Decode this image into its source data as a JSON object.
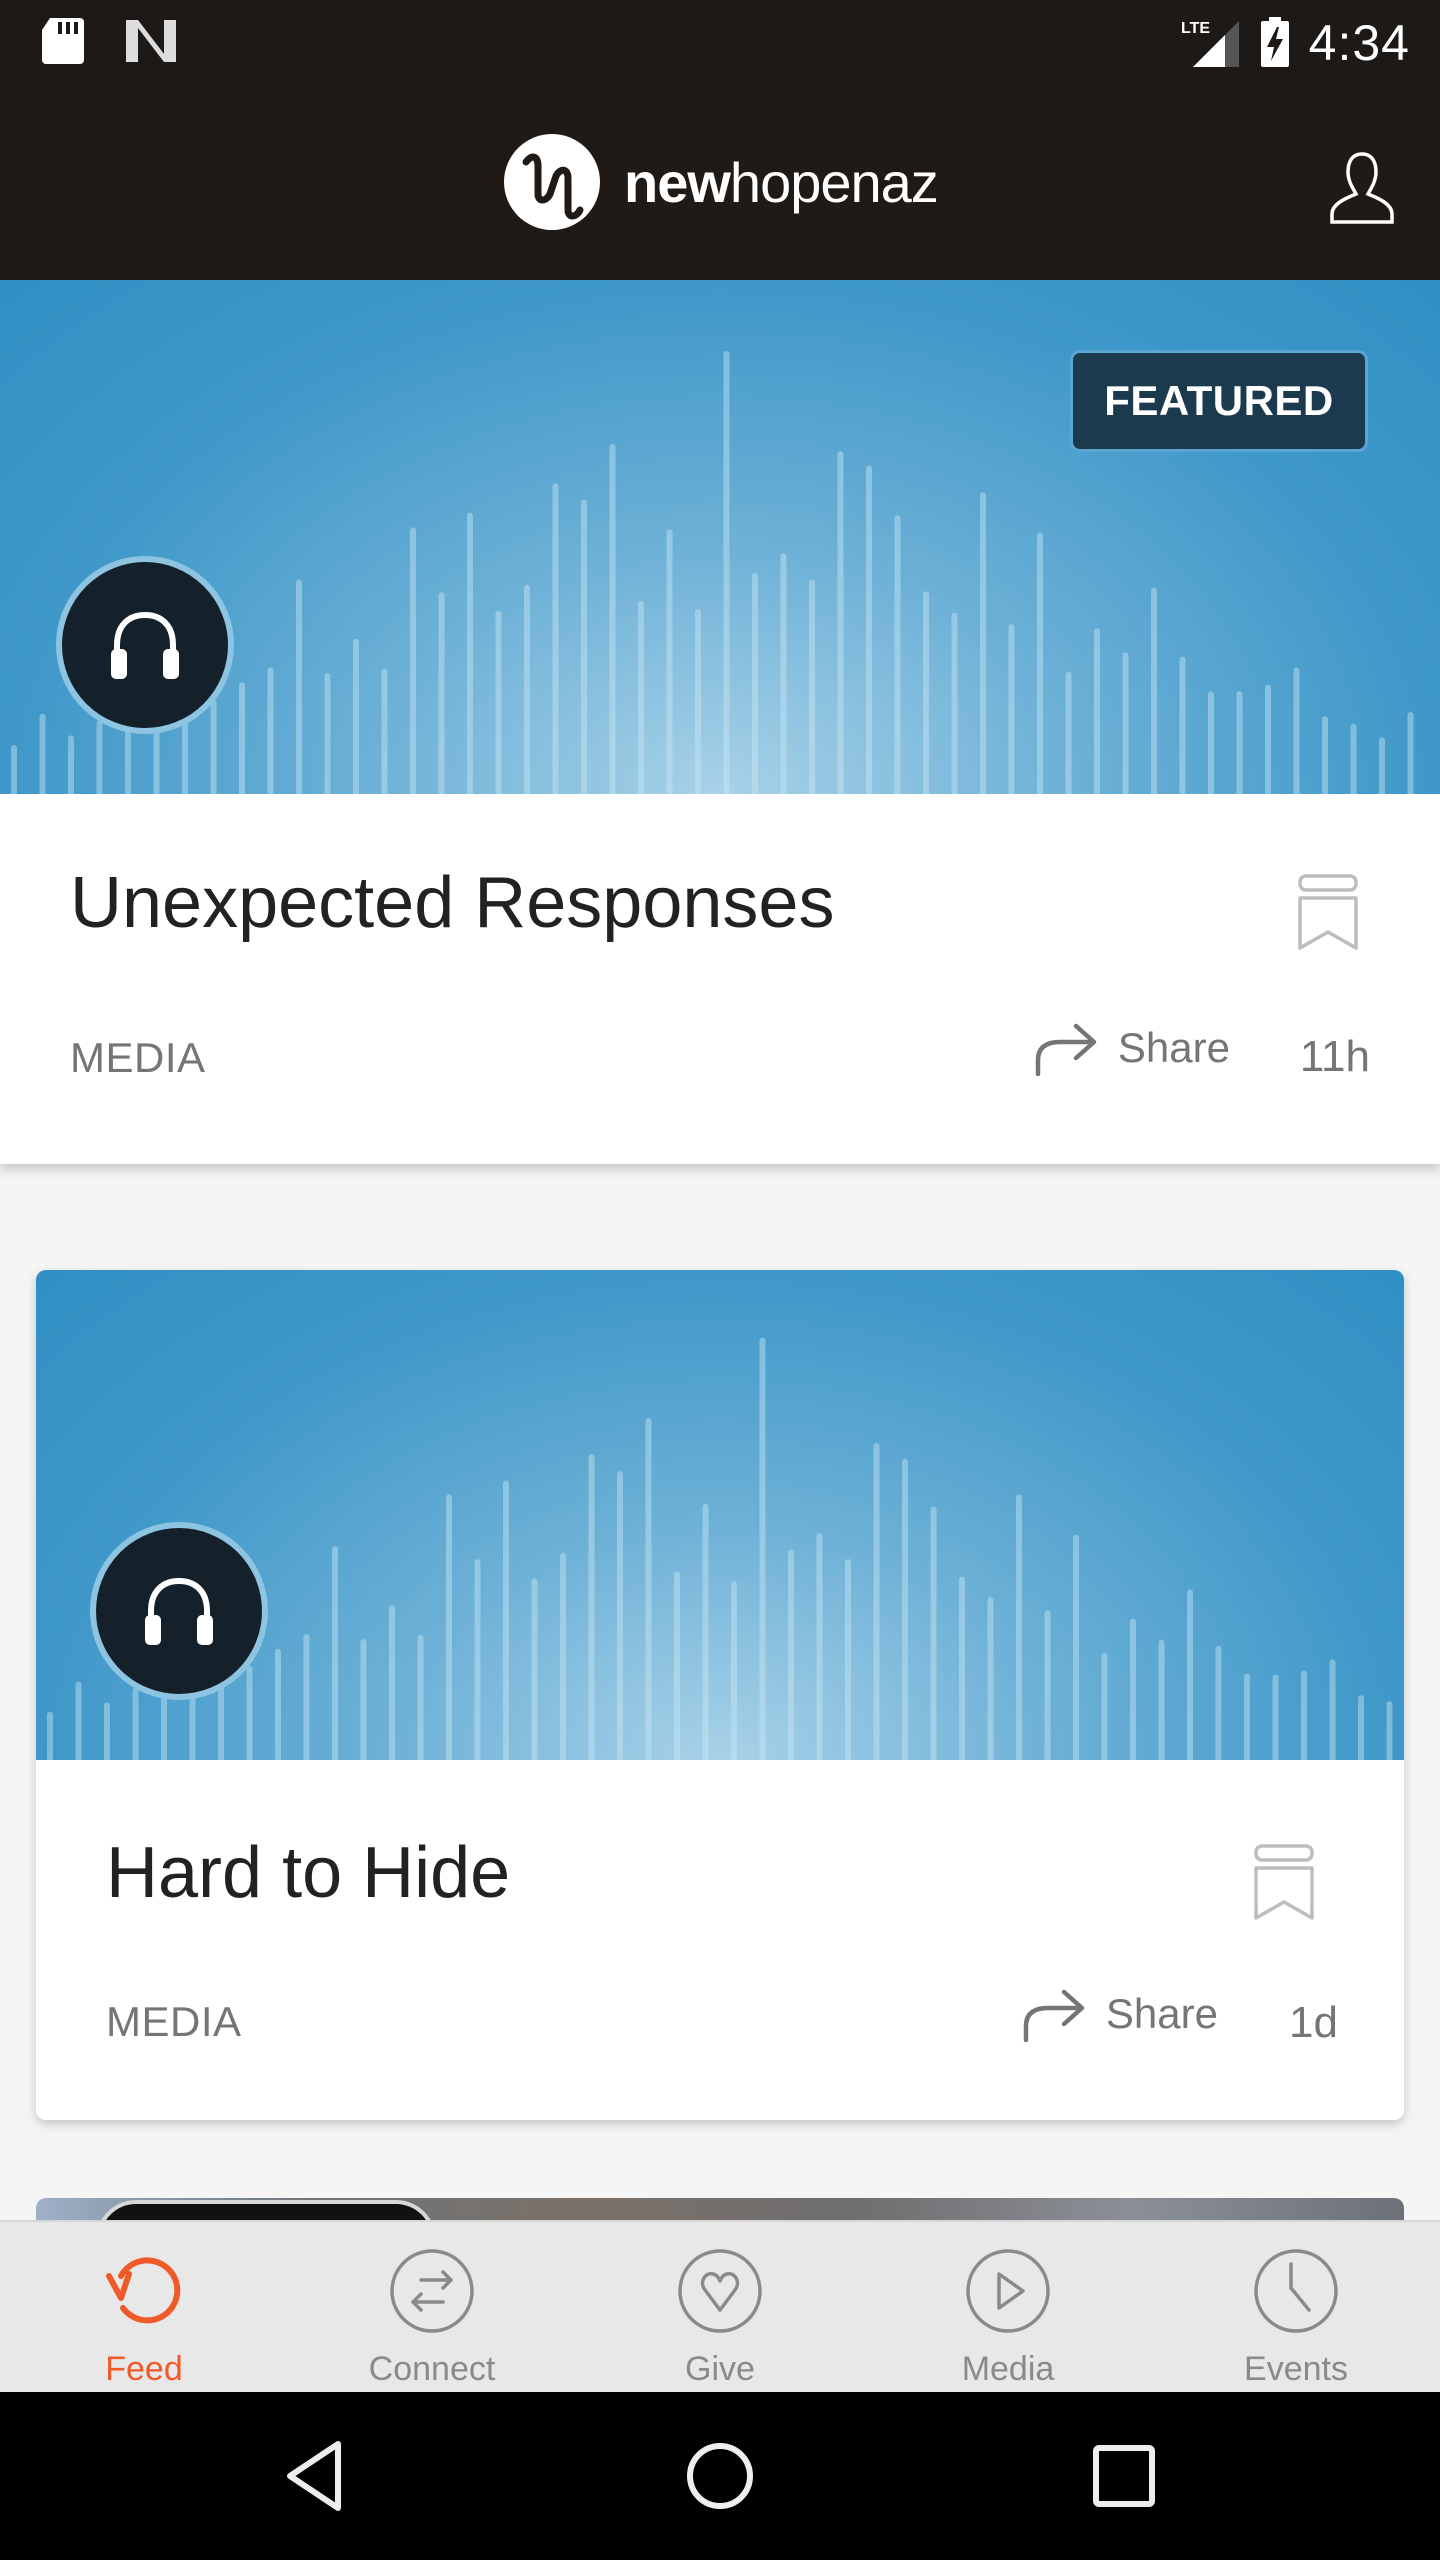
{
  "status_bar": {
    "time": "4:34",
    "network": "LTE",
    "left_icons": [
      "sd-card-icon",
      "n-notification-icon"
    ],
    "right_icons": [
      "lte-signal-icon",
      "battery-charging-icon"
    ]
  },
  "app_bar": {
    "logo_bold": "new",
    "logo_regular": "hopenaz",
    "profile_icon": "person-outline-icon"
  },
  "feed": {
    "featured": {
      "badge": "FEATURED",
      "title": "Unexpected Responses",
      "category": "MEDIA",
      "share_label": "Share",
      "time": "11h",
      "media_icon": "headphones-icon"
    },
    "items": [
      {
        "title": "Hard to Hide",
        "category": "MEDIA",
        "share_label": "Share",
        "time": "1d",
        "media_icon": "headphones-icon"
      }
    ]
  },
  "bottom_nav": {
    "active": "Feed",
    "active_color": "#f05a28",
    "inactive_color": "#8a8a8a",
    "items": [
      {
        "label": "Feed",
        "icon": "refresh-icon"
      },
      {
        "label": "Connect",
        "icon": "swap-arrows-icon"
      },
      {
        "label": "Give",
        "icon": "heart-icon"
      },
      {
        "label": "Media",
        "icon": "play-icon"
      },
      {
        "label": "Events",
        "icon": "clock-icon"
      }
    ]
  },
  "system_nav": {
    "buttons": [
      "back",
      "home",
      "recents"
    ]
  }
}
